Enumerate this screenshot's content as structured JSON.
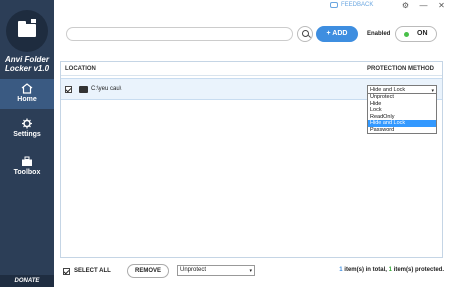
{
  "app": {
    "title_line1": "Anvi Folder",
    "title_line2": "Locker v1.0"
  },
  "titlebar": {
    "feedback_label": "FEEDBACK",
    "settings_glyph": "⚙",
    "minimize_glyph": "—",
    "close_glyph": "✕"
  },
  "sidebar": {
    "items": [
      {
        "label": "Home",
        "icon": "home-icon",
        "active": true
      },
      {
        "label": "Settings",
        "icon": "gear-icon",
        "active": false
      },
      {
        "label": "Toolbox",
        "icon": "toolbox-icon",
        "active": false
      }
    ],
    "donate_label": "DONATE"
  },
  "toolbar": {
    "search_placeholder": "",
    "add_label": "+ ADD",
    "enabled_label": "Enabled",
    "toggle_label": "ON"
  },
  "table": {
    "columns": [
      "LOCATION",
      "PROTECTION METHOD"
    ],
    "rows": [
      {
        "checked": true,
        "path": "C:\\yeu cau\\",
        "method": "Hide and Lock"
      }
    ],
    "dropdown_options": [
      "Unprotect",
      "Hide",
      "Lock",
      "ReadOnly",
      "Hide and Lock",
      "Password"
    ],
    "dropdown_selected": "Hide and Lock"
  },
  "footer": {
    "select_all_label": "SELECT ALL",
    "remove_label": "REMOVE",
    "method_value": "Unprotect",
    "total_count": "1",
    "total_text": " item(s) in total, ",
    "protected_count": "1",
    "protected_text": " item(s) protected."
  },
  "colors": {
    "sidebar_bg": "#2c3e57",
    "accent_blue": "#3e8ee0",
    "on_green": "#49c049",
    "selected_option": "#3399ff"
  }
}
